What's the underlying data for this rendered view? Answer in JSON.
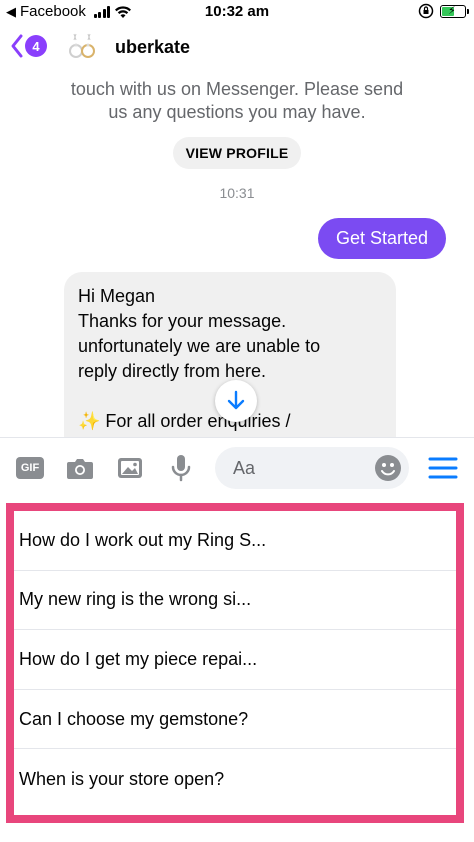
{
  "status_bar": {
    "back_app": "Facebook",
    "time": "10:32 am"
  },
  "header": {
    "unread_count": "4",
    "contact_name": "uberkate"
  },
  "conversation": {
    "intro_line_1": "touch with us on Messenger. Please send",
    "intro_line_2": "us any questions you may have.",
    "view_profile_label": "VIEW PROFILE",
    "timestamp": "10:31",
    "outgoing_message": "Get Started",
    "incoming_message": "Hi Megan\nThanks for your message.\nunfortunately we are unable to\nreply directly from here.\n\n✨ For all order enquiries /"
  },
  "composer": {
    "gif_label": "GIF",
    "placeholder": "Aa"
  },
  "quick_replies": [
    {
      "label": "How do I work out my Ring S..."
    },
    {
      "label": "My new ring is the wrong si..."
    },
    {
      "label": "How do I get my piece repai..."
    },
    {
      "label": "Can I choose my gemstone?"
    },
    {
      "label": "When is your store open?"
    }
  ],
  "colors": {
    "brand_purple": "#7b4bf2",
    "badge_purple": "#8a3ffc",
    "highlight_border": "#e8467c",
    "blue_accent": "#0a7cff"
  },
  "icons": [
    "back-chevron-icon",
    "signal-icon",
    "wifi-icon",
    "orientation-lock-icon",
    "battery-icon",
    "camera-icon",
    "image-icon",
    "microphone-icon",
    "emoji-icon",
    "menu-icon",
    "arrow-down-icon"
  ]
}
